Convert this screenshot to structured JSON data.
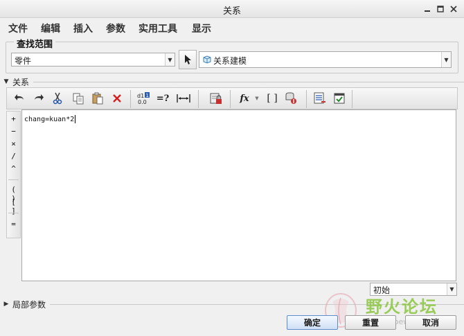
{
  "window": {
    "title": "关系",
    "controls": [
      "minimize",
      "maximize",
      "close"
    ]
  },
  "menu": [
    "文件",
    "编辑",
    "插入",
    "参数",
    "实用工具",
    "显示"
  ],
  "lookup": {
    "group_label": "查找范围",
    "type_value": "零件",
    "scope_value": "关系建模"
  },
  "relations": {
    "section_label": "关系",
    "text": "chang=kuan*2",
    "toolbar": {
      "buttons": [
        "undo-icon",
        "redo-icon",
        "cut-icon",
        "copy-icon",
        "paste-icon",
        "delete-icon",
        "show-values-icon",
        "evaluate-icon",
        "dimension-icon",
        "lock-icon",
        "function-icon",
        "parameters-icon",
        "sort-icon",
        "list-icon",
        "verify-icon"
      ],
      "evaluate_label": "=?",
      "function_label": "fx",
      "brackets_label": "[ ]"
    },
    "operators": [
      "+",
      "−",
      "×",
      "/",
      "^",
      "( )",
      "[ ]",
      "="
    ]
  },
  "footer": {
    "units_value": "初始",
    "local_params_label": "局部参数",
    "ok_label": "确定",
    "reset_label": "重置",
    "cancel_label": "取消"
  },
  "watermark": {
    "text": "野火论坛",
    "url": "www.proewildfire.cn"
  },
  "colors": {
    "window_bg": "#f0f0f0",
    "editor_bg": "#ffffff",
    "primary_border": "#5c8ccc",
    "delete_red": "#d21f1f",
    "watermark_green": "#8cc63f"
  }
}
